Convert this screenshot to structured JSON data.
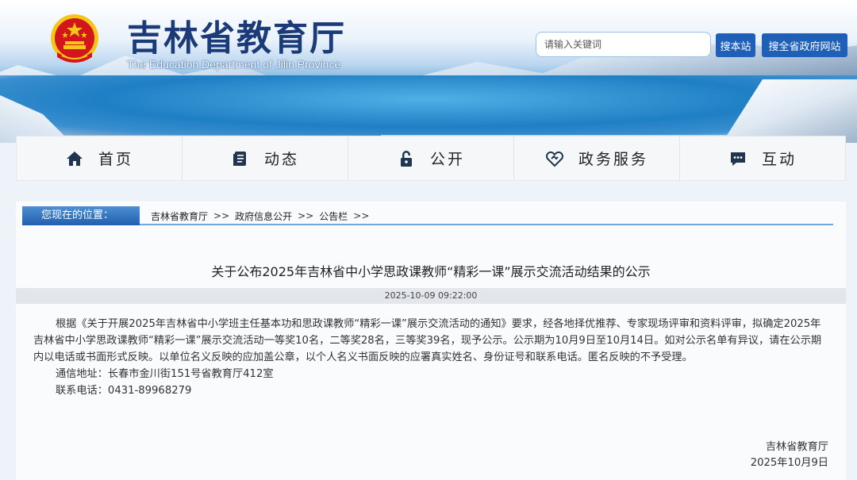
{
  "header": {
    "title": "吉林省教育厅",
    "subtitle": "The Education Department of Jilin Province",
    "search": {
      "placeholder": "请输入关键词",
      "site_button": "搜本站",
      "gov_button": "搜全省政府网站"
    }
  },
  "nav": {
    "items": [
      {
        "label": "首页",
        "icon": "home-icon"
      },
      {
        "label": "动态",
        "icon": "document-icon"
      },
      {
        "label": "公开",
        "icon": "lock-icon"
      },
      {
        "label": "政务服务",
        "icon": "heart-handshake-icon"
      },
      {
        "label": "互动",
        "icon": "chat-icon"
      }
    ]
  },
  "breadcrumb": {
    "label": "您现在的位置：",
    "items": [
      "吉林省教育厅",
      "政府信息公开",
      "公告栏"
    ],
    "separator": ">>"
  },
  "article": {
    "title": "关于公布2025年吉林省中小学思政课教师“精彩一课”展示交流活动结果的公示",
    "date": "2025-10-09 09:22:00",
    "paragraph": "根据《关于开展2025年吉林省中小学班主任基本功和思政课教师“精彩一课”展示交流活动的通知》要求，经各地择优推荐、专家现场评审和资料评审，拟确定2025年吉林省中小学思政课教师“精彩一课”展示交流活动一等奖10名，二等奖28名，三等奖39名，现予公示。公示期为10月9日至10月14日。如对公示名单有异议，请在公示期内以电话或书面形式反映。以单位名义反映的应加盖公章，以个人名义书面反映的应署真实姓名、身份证号和联系电话。匿名反映的不予受理。",
    "address": "通信地址：长春市金川街151号省教育厅412室",
    "phone": "联系电话：0431-89968279",
    "signer": "吉林省教育厅",
    "sign_date": "2025年10月9日"
  },
  "colors": {
    "brand": "#1e5fb8",
    "title_blue": "#1a3a78",
    "emblem_red": "#d2161b",
    "emblem_gold": "#f5c518"
  }
}
